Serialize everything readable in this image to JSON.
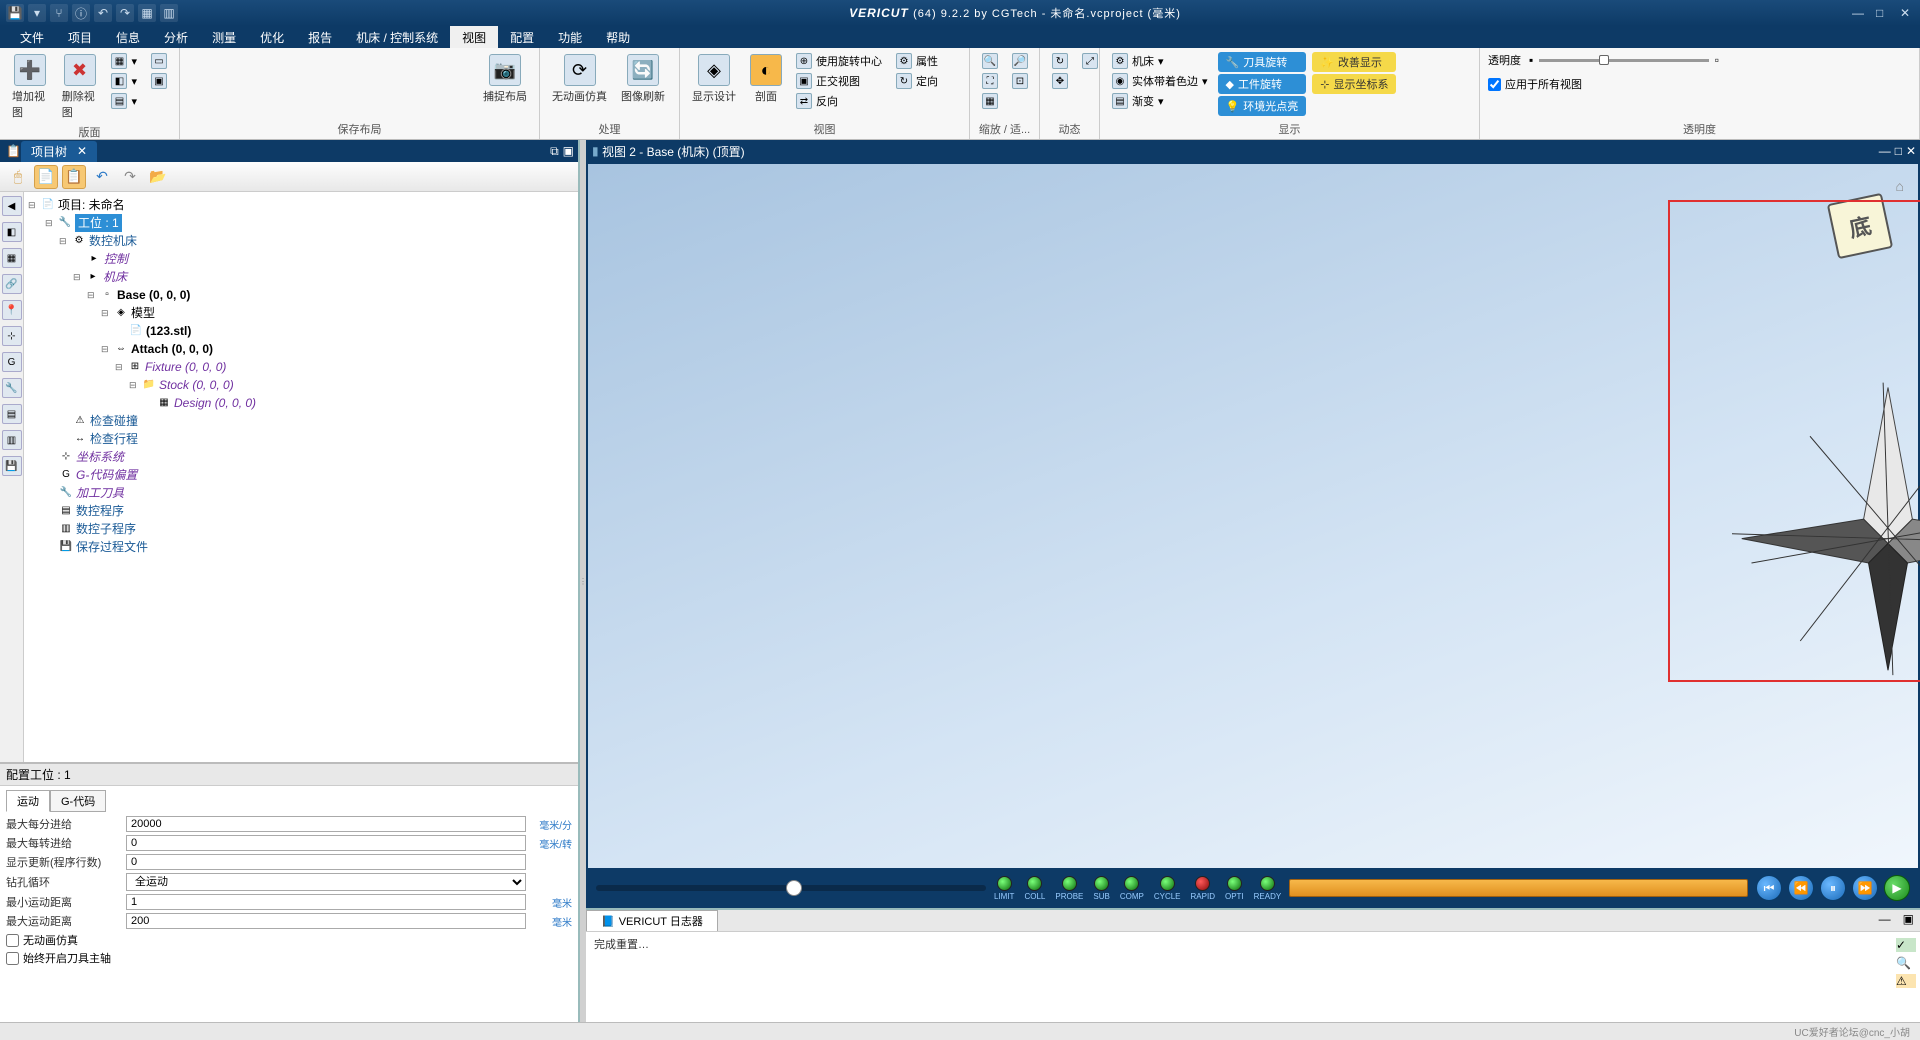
{
  "titlebar": {
    "brand": "VERICUT",
    "suffix": "(64) 9.2.2 by CGTech - 未命名.vcproject (毫米)"
  },
  "menu": {
    "items": [
      "文件",
      "项目",
      "信息",
      "分析",
      "测量",
      "优化",
      "报告",
      "机床 / 控制系统",
      "视图",
      "配置",
      "功能",
      "帮助"
    ],
    "active_index": 8
  },
  "ribbon": {
    "groups": {
      "panel": {
        "label": "版面",
        "btn_add": "增加视图",
        "btn_del": "删除视图"
      },
      "layout": {
        "label": "保存布局",
        "btn_capture": "捕捉布局"
      },
      "process": {
        "label": "处理",
        "btn_noanim": "无动画仿真",
        "btn_refresh": "图像刷新"
      },
      "view": {
        "label": "视图",
        "btn_design": "显示设计",
        "btn_section": "剖面",
        "opt_center": "使用旋转中心",
        "opt_ortho": "正交视图",
        "opt_reverse": "反向",
        "opt_attr": "属性",
        "opt_orient": "定向"
      },
      "zoom": {
        "label": "缩放 / 适..."
      },
      "dynamic": {
        "label": "动态"
      },
      "display": {
        "label": "显示",
        "opt_machine": "机床",
        "opt_solid": "实体带着色边",
        "opt_transform": "渐变",
        "chip_tool": "刀具旋转",
        "chip_part": "工件旋转",
        "chip_env": "环境光点亮",
        "chip_improve": "改善显示",
        "chip_coords": "显示坐标系"
      },
      "transparency": {
        "label": "透明度",
        "title": "透明度",
        "opt_all": "应用于所有视图"
      }
    }
  },
  "project_tree": {
    "tab": "项目树",
    "root": "项目: 未命名",
    "setup": "工位 : 1",
    "machine": "数控机床",
    "control": "控制",
    "machine2": "机床",
    "base": "Base (0, 0, 0)",
    "model": "模型",
    "stl": "(123.stl)",
    "attach": "Attach (0, 0, 0)",
    "fixture": "Fixture (0, 0, 0)",
    "stock": "Stock (0, 0, 0)",
    "design": "Design (0, 0, 0)",
    "check_collision": "检查碰撞",
    "check_travel": "检查行程",
    "coord_sys": "坐标系统",
    "gcode_offset": "G-代码偏置",
    "tools": "加工刀具",
    "nc_prog": "数控程序",
    "nc_sub": "数控子程序",
    "save_proc": "保存过程文件"
  },
  "viewport": {
    "header": "视图 2 - Base (机床) (顶置)",
    "orient_label": "底"
  },
  "playbar": {
    "leds": [
      {
        "label": "LIMIT",
        "c1": "#7aff7a",
        "c2": "#0a6a0a"
      },
      {
        "label": "COLL",
        "c1": "#7aff7a",
        "c2": "#0a6a0a"
      },
      {
        "label": "PROBE",
        "c1": "#7aff7a",
        "c2": "#0a6a0a"
      },
      {
        "label": "SUB",
        "c1": "#7aff7a",
        "c2": "#0a6a0a"
      },
      {
        "label": "COMP",
        "c1": "#7aff7a",
        "c2": "#0a6a0a"
      },
      {
        "label": "CYCLE",
        "c1": "#7aff7a",
        "c2": "#0a6a0a"
      },
      {
        "label": "RAPID",
        "c1": "#ff5a5a",
        "c2": "#8a0a0a"
      },
      {
        "label": "OPTI",
        "c1": "#7aff7a",
        "c2": "#0a6a0a"
      },
      {
        "label": "READY",
        "c1": "#7aff7a",
        "c2": "#0a6a0a"
      }
    ]
  },
  "config": {
    "header": "配置工位 : 1",
    "tab_motion": "运动",
    "tab_gcode": "G-代码",
    "rows": {
      "max_feed": {
        "label": "最大每分进给",
        "value": "20000",
        "unit": "毫米/分"
      },
      "max_rev": {
        "label": "最大每转进给",
        "value": "0",
        "unit": "毫米/转"
      },
      "update_lines": {
        "label": "显示更新(程序行数)",
        "value": "0",
        "unit": ""
      },
      "drill_cycle": {
        "label": "钻孔循环",
        "value": "全运动",
        "unit": ""
      },
      "min_move": {
        "label": "最小运动距离",
        "value": "1",
        "unit": "毫米"
      },
      "max_move": {
        "label": "最大运动距离",
        "value": "200",
        "unit": "毫米"
      }
    },
    "chk_noanim": "无动画仿真",
    "chk_always_spindle": "始终开启刀具主轴"
  },
  "log": {
    "tab": "VERICUT 日志器",
    "content": "完成重置…"
  },
  "statusbar": {
    "watermark": "UC爱好者论坛@cnc_小胡"
  }
}
